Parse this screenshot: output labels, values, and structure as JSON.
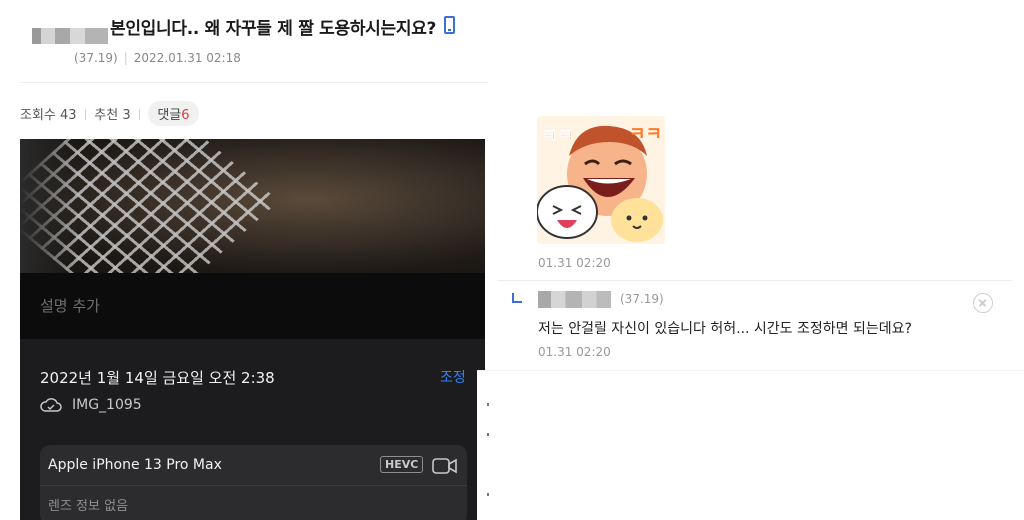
{
  "post": {
    "title": "본인입니다.. 왜 자꾸들 제 짤 도용하시는지요?",
    "author_ip": "(37.19)",
    "date": "2022.01.31 02:18",
    "mobile_icon": "mobile-phone-icon",
    "stats": {
      "views_label": "조회수 43",
      "recommend_label": "추천 3",
      "comment_label": "댓글",
      "comment_count": "6"
    }
  },
  "photo_info": {
    "add_description": "설명 추가",
    "datetime": "2022년 1월 14일 금요일 오전 2:38",
    "adjust": "조정",
    "filename": "IMG_1095",
    "device": "Apple iPhone 13 Pro Max",
    "format_badge": "HEVC",
    "lens_info": "렌즈 정보 없음"
  },
  "comments": [
    {
      "type": "sticker",
      "sticker_text": "ㅋㅋ",
      "time": "01.31 02:20"
    },
    {
      "type": "reply",
      "ip": "(37.19)",
      "text": "저는 안걸릴 자신이 있습니다 허허... 시간도 조정하면 되는데요?",
      "time": "01.31 02:20"
    }
  ],
  "colors": {
    "accent_blue": "#3b6fd6",
    "comment_count_red": "#e03a3a",
    "ios_blue": "#2f7ff7"
  }
}
